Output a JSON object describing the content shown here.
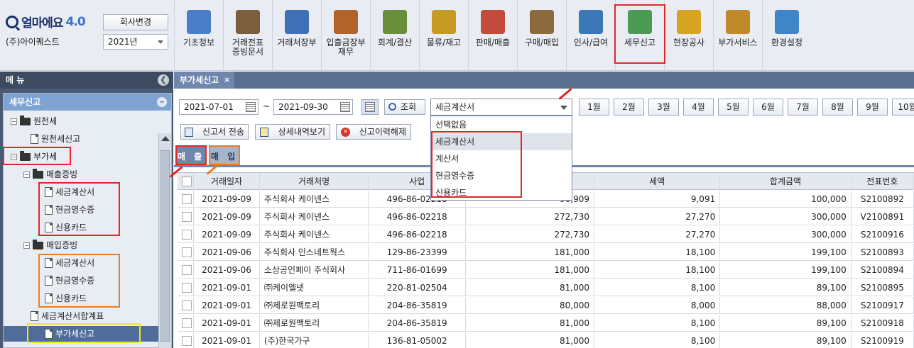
{
  "header": {
    "logo_text": "얼마에요",
    "logo_version": "4.0",
    "company_name": "(주)아이퀘스트",
    "change_company_label": "회사변경",
    "year_value": "2021년"
  },
  "toolbar": [
    {
      "label": "기초정보",
      "icon": "basic-info-icon"
    },
    {
      "label": "거래전표\n증빙문서",
      "icon": "voucher-icon"
    },
    {
      "label": "거래처장부",
      "icon": "ledger-icon"
    },
    {
      "label": "입출금장부\n재무",
      "icon": "cashbook-icon"
    },
    {
      "label": "회계/결산",
      "icon": "accounting-icon"
    },
    {
      "label": "물류/재고",
      "icon": "logistics-icon"
    },
    {
      "label": "판매/매출",
      "icon": "sales-icon"
    },
    {
      "label": "구매/매입",
      "icon": "purchase-icon"
    },
    {
      "label": "인사/급여",
      "icon": "hr-icon"
    },
    {
      "label": "세무신고",
      "icon": "tax-report-icon"
    },
    {
      "label": "현장공사",
      "icon": "construction-icon"
    },
    {
      "label": "부가서비스",
      "icon": "service-icon"
    },
    {
      "label": "환경설정",
      "icon": "settings-icon"
    }
  ],
  "sidebar": {
    "header": "메 뉴",
    "section_title": "세무신고",
    "tree": [
      {
        "label": "원천세",
        "type": "folder"
      },
      {
        "label": "원천세신고",
        "type": "doc"
      },
      {
        "label": "부가세",
        "type": "folder"
      },
      {
        "label": "매출증빙",
        "type": "folder"
      },
      {
        "label": "세금계산서",
        "type": "doc"
      },
      {
        "label": "현금영수증",
        "type": "doc"
      },
      {
        "label": "신용카드",
        "type": "doc"
      },
      {
        "label": "매입증빙",
        "type": "folder"
      },
      {
        "label": "세금계산서",
        "type": "doc"
      },
      {
        "label": "현금영수증",
        "type": "doc"
      },
      {
        "label": "신용카드",
        "type": "doc"
      },
      {
        "label": "세금계산서합계표",
        "type": "doc"
      },
      {
        "label": "부가세신고",
        "type": "doc"
      }
    ]
  },
  "main": {
    "tab_label": "부가세신고",
    "tab_close": "×",
    "date_from": "2021-07-01",
    "date_sep": "~",
    "date_to": "2021-09-30",
    "search_label": "조회",
    "dropdown_value": "세금계산서",
    "dropdown_options": [
      "선택없음",
      "세금계산서",
      "계산서",
      "현금영수증",
      "신용카드"
    ],
    "months": [
      "1월",
      "2월",
      "3월",
      "4월",
      "5월",
      "6월",
      "7월",
      "8월",
      "9월",
      "10월"
    ],
    "actions": [
      "신고서 전송",
      "상세내역보기",
      "신고이력해제"
    ],
    "subtabs": [
      "매 출",
      "매 입"
    ]
  },
  "table": {
    "columns": [
      "",
      "거래일자",
      "거래처명",
      "사업",
      "",
      "세액",
      "합계금액",
      "전표번호"
    ],
    "rows": [
      [
        "2021-09-09",
        "주식회사 케이넨스",
        "496-86-02218",
        "90,909",
        "9,091",
        "100,000",
        "S2100892"
      ],
      [
        "2021-09-09",
        "주식회사 케이넨스",
        "496-86-02218",
        "272,730",
        "27,270",
        "300,000",
        "V2100891"
      ],
      [
        "2021-09-09",
        "주식회사 케이넨스",
        "496-86-02218",
        "272,730",
        "27,270",
        "300,000",
        "S2100916"
      ],
      [
        "2021-09-06",
        "주식회사 인스네트웍스",
        "129-86-23399",
        "181,000",
        "18,100",
        "199,100",
        "S2100893"
      ],
      [
        "2021-09-06",
        "소상공인페이 주식회사",
        "711-86-01699",
        "181,000",
        "18,100",
        "199,100",
        "S2100894"
      ],
      [
        "2021-09-01",
        "㈜케이엘넷",
        "220-81-02504",
        "81,000",
        "8,100",
        "89,100",
        "S2100895"
      ],
      [
        "2021-09-01",
        "㈜제로원팩토리",
        "204-86-35819",
        "80,000",
        "8,000",
        "88,000",
        "S2100917"
      ],
      [
        "2021-09-01",
        "㈜제로원팩토리",
        "204-86-35819",
        "81,000",
        "8,100",
        "89,100",
        "S2100918"
      ],
      [
        "2021-09-01",
        "(주)한국가구",
        "136-81-05002",
        "81,000",
        "8,100",
        "89,100",
        "S2100919"
      ]
    ]
  },
  "colors": {
    "red_box": "#e3262a",
    "orange_box": "#f07c1f",
    "yellow_box": "#f4e41c",
    "sidebar_bg": "#4a5a75",
    "accent": "#6f86ad"
  }
}
